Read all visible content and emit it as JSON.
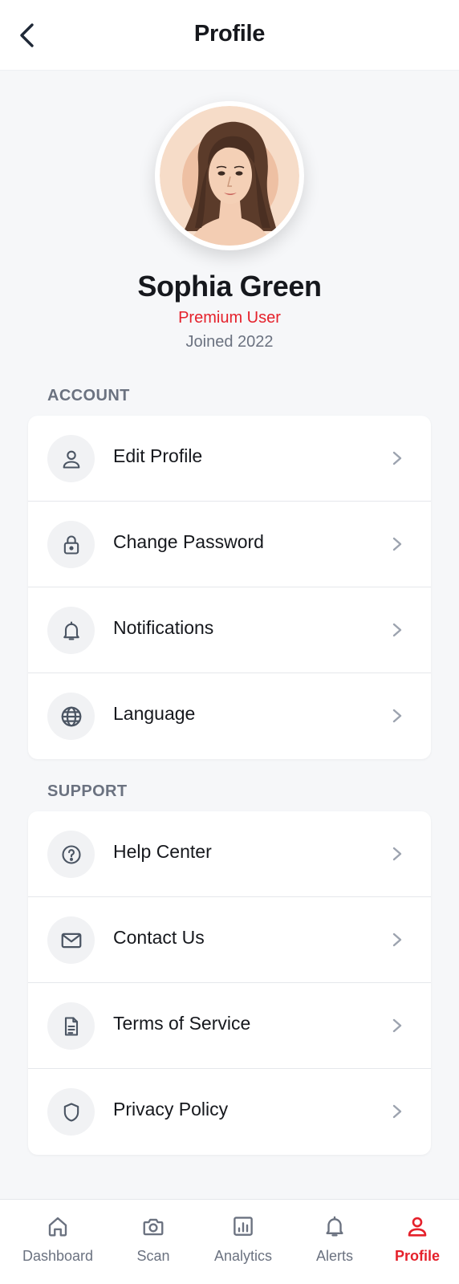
{
  "header": {
    "title": "Profile",
    "back_icon": "chevron-left-icon"
  },
  "profile": {
    "name": "Sophia Green",
    "tier": "Premium User",
    "joined": "Joined 2022",
    "avatar_icon": "user-portrait"
  },
  "sections": {
    "account": {
      "title": "ACCOUNT",
      "items": [
        {
          "label": "Edit Profile",
          "icon": "user-icon"
        },
        {
          "label": "Change Password",
          "icon": "lock-icon"
        },
        {
          "label": "Notifications",
          "icon": "bell-icon"
        },
        {
          "label": "Language",
          "icon": "globe-icon"
        }
      ]
    },
    "support": {
      "title": "SUPPORT",
      "items": [
        {
          "label": "Help Center",
          "icon": "help-circle-icon"
        },
        {
          "label": "Contact Us",
          "icon": "mail-icon"
        },
        {
          "label": "Terms of Service",
          "icon": "document-icon"
        },
        {
          "label": "Privacy Policy",
          "icon": "shield-icon"
        }
      ]
    }
  },
  "bottom_nav": {
    "items": [
      {
        "label": "Dashboard",
        "icon": "home-icon",
        "active": false
      },
      {
        "label": "Scan",
        "icon": "camera-icon",
        "active": false
      },
      {
        "label": "Analytics",
        "icon": "bar-chart-icon",
        "active": false
      },
      {
        "label": "Alerts",
        "icon": "bell-icon",
        "active": false
      },
      {
        "label": "Profile",
        "icon": "user-icon",
        "active": true
      }
    ]
  },
  "colors": {
    "accent": "#e5212b",
    "text_primary": "#16181d",
    "text_secondary": "#6b7280",
    "background": "#f6f7f9",
    "icon_bg": "#f1f2f4"
  }
}
